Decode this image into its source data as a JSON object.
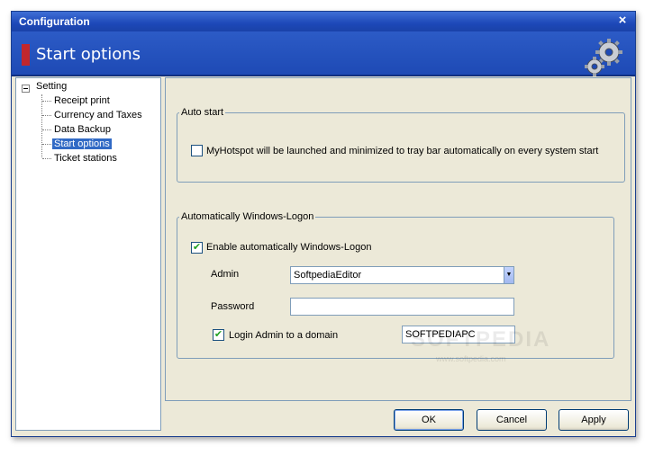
{
  "window": {
    "title": "Configuration",
    "close_glyph": "×",
    "header_title": "Start options",
    "header_icon": "gears-icon"
  },
  "tree": {
    "root": "Setting",
    "expander_glyph": "−",
    "items": [
      {
        "label": "Receipt print",
        "selected": false
      },
      {
        "label": "Currency and Taxes",
        "selected": false
      },
      {
        "label": "Data Backup",
        "selected": false
      },
      {
        "label": "Start options",
        "selected": true
      },
      {
        "label": "Ticket stations",
        "selected": false
      }
    ]
  },
  "auto_start": {
    "legend": "Auto start",
    "checkbox_label": "MyHotspot will be launched and minimized to tray bar automatically on every system start",
    "checked": false
  },
  "windows_logon": {
    "legend": "Automatically Windows-Logon",
    "enable_label": "Enable automatically Windows-Logon",
    "enable_checked": true,
    "admin_label": "Admin",
    "admin_value": "SoftpediaEditor",
    "password_label": "Password",
    "password_value": "",
    "domain_label": "Login Admin to a domain",
    "domain_checked": true,
    "domain_value": "SOFTPEDIAPC"
  },
  "buttons": {
    "ok": "OK",
    "cancel": "Cancel",
    "apply": "Apply"
  },
  "watermark": {
    "main": "SOFTPEDIA",
    "sub": "www.softpedia.com"
  },
  "colors": {
    "title_blue": "#1d48b8",
    "header_marker": "#c1272d",
    "selection": "#316ac5",
    "check_green": "#21a121"
  }
}
